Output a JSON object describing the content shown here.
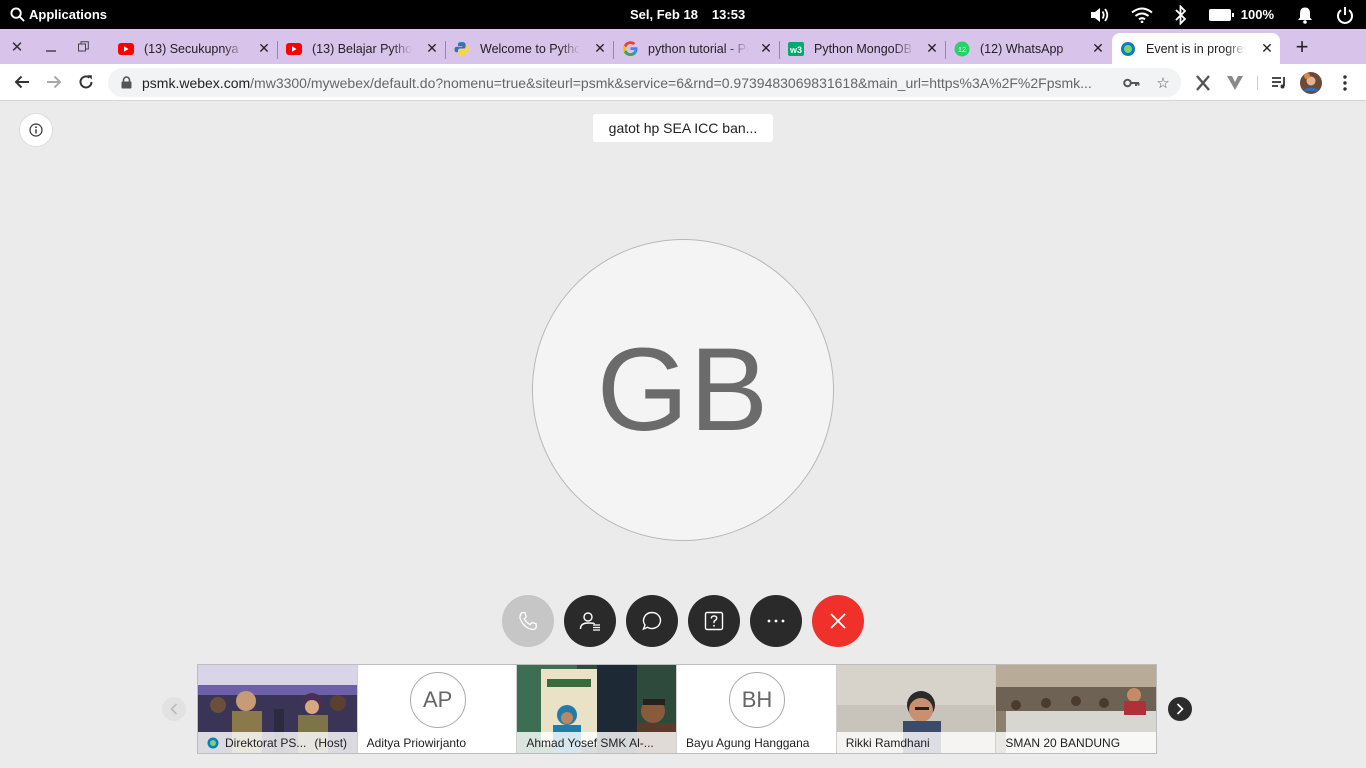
{
  "system": {
    "applications_label": "Applications",
    "date": "Sel, Feb 18",
    "time": "13:53",
    "battery": "100%"
  },
  "tabs": [
    {
      "title": "(13) Secukupnya -",
      "icon": "youtube-icon"
    },
    {
      "title": "(13) Belajar Python",
      "icon": "youtube-icon"
    },
    {
      "title": "Welcome to Python",
      "icon": "python-icon"
    },
    {
      "title": "python tutorial - Pe",
      "icon": "google-icon"
    },
    {
      "title": "Python MongoDB I",
      "icon": "w3schools-icon"
    },
    {
      "title": "(12) WhatsApp",
      "icon": "whatsapp-icon"
    },
    {
      "title": "Event is in progress",
      "icon": "webex-icon",
      "active": true
    }
  ],
  "address_bar": {
    "domain": "psmk.webex.com",
    "path": "/mw3300/mywebex/default.do?nomenu=true&siteurl=psmk&service=6&rnd=0.9739483069831618&main_url=https%3A%2F%2Fpsmk..."
  },
  "meeting": {
    "active_speaker": "gatot hp SEA ICC ban...",
    "avatar_initials": "GB"
  },
  "participants": [
    {
      "name": "Direktorat PS...",
      "tag": "(Host)",
      "type": "video"
    },
    {
      "name": "Aditya Priowirjanto",
      "initials": "AP",
      "type": "avatar"
    },
    {
      "name": "Ahmad Yosef SMK Al-...",
      "type": "video"
    },
    {
      "name": "Bayu Agung Hanggana",
      "initials": "BH",
      "type": "avatar"
    },
    {
      "name": "Rikki Ramdhani",
      "type": "video"
    },
    {
      "name": "SMAN 20 BANDUNG",
      "type": "video"
    }
  ],
  "colors": {
    "tab_strip": "#d8c3ea",
    "leave_button": "#f0302a",
    "control_button": "#2a2a2a"
  }
}
